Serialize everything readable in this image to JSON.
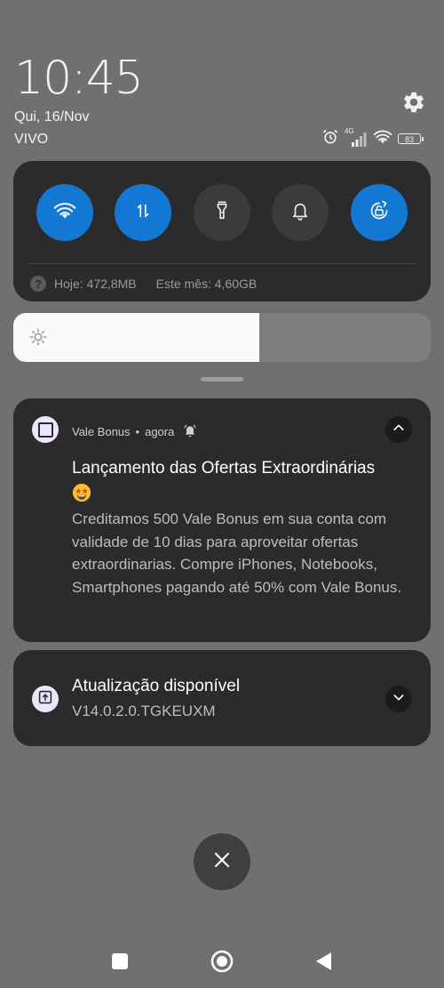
{
  "header": {
    "time": "10:45",
    "date": "Qui, 16/Nov",
    "carrier": "VIVO",
    "network_type": "4G",
    "battery_level": "83",
    "settings_icon": "gear-icon"
  },
  "quick_settings": {
    "tiles": [
      {
        "name": "wifi",
        "icon": "wifi-icon",
        "active": true
      },
      {
        "name": "mobile-data",
        "icon": "data-transfer-icon",
        "active": true
      },
      {
        "name": "flashlight",
        "icon": "flashlight-icon",
        "active": false
      },
      {
        "name": "silent",
        "icon": "bell-icon",
        "active": false
      },
      {
        "name": "auto-rotate",
        "icon": "rotation-lock-icon",
        "active": true
      }
    ],
    "data_usage": {
      "today": "Hoje: 472,8MB",
      "month": "Este mês: 4,60GB"
    }
  },
  "brightness": {
    "level": 0.59
  },
  "notifications": [
    {
      "app": "Vale Bonus",
      "separator": "•",
      "time": "agora",
      "title": "Lançamento das Ofertas Extraordinárias",
      "emoji": "star-struck-emoji",
      "body": "Creditamos 500 Vale Bonus em sua conta com validade de 10 dias para aproveitar ofertas extraordinarias. Compre iPhones, Notebooks, Smartphones pagando até 50% com Vale Bonus.",
      "expanded": true
    },
    {
      "title": "Atualização disponível",
      "body": "V14.0.2.0.TGKEUXM",
      "expanded": false
    }
  ],
  "colors": {
    "background": "#707070",
    "panel": "#2b2b2d",
    "accent": "#1377d4"
  }
}
